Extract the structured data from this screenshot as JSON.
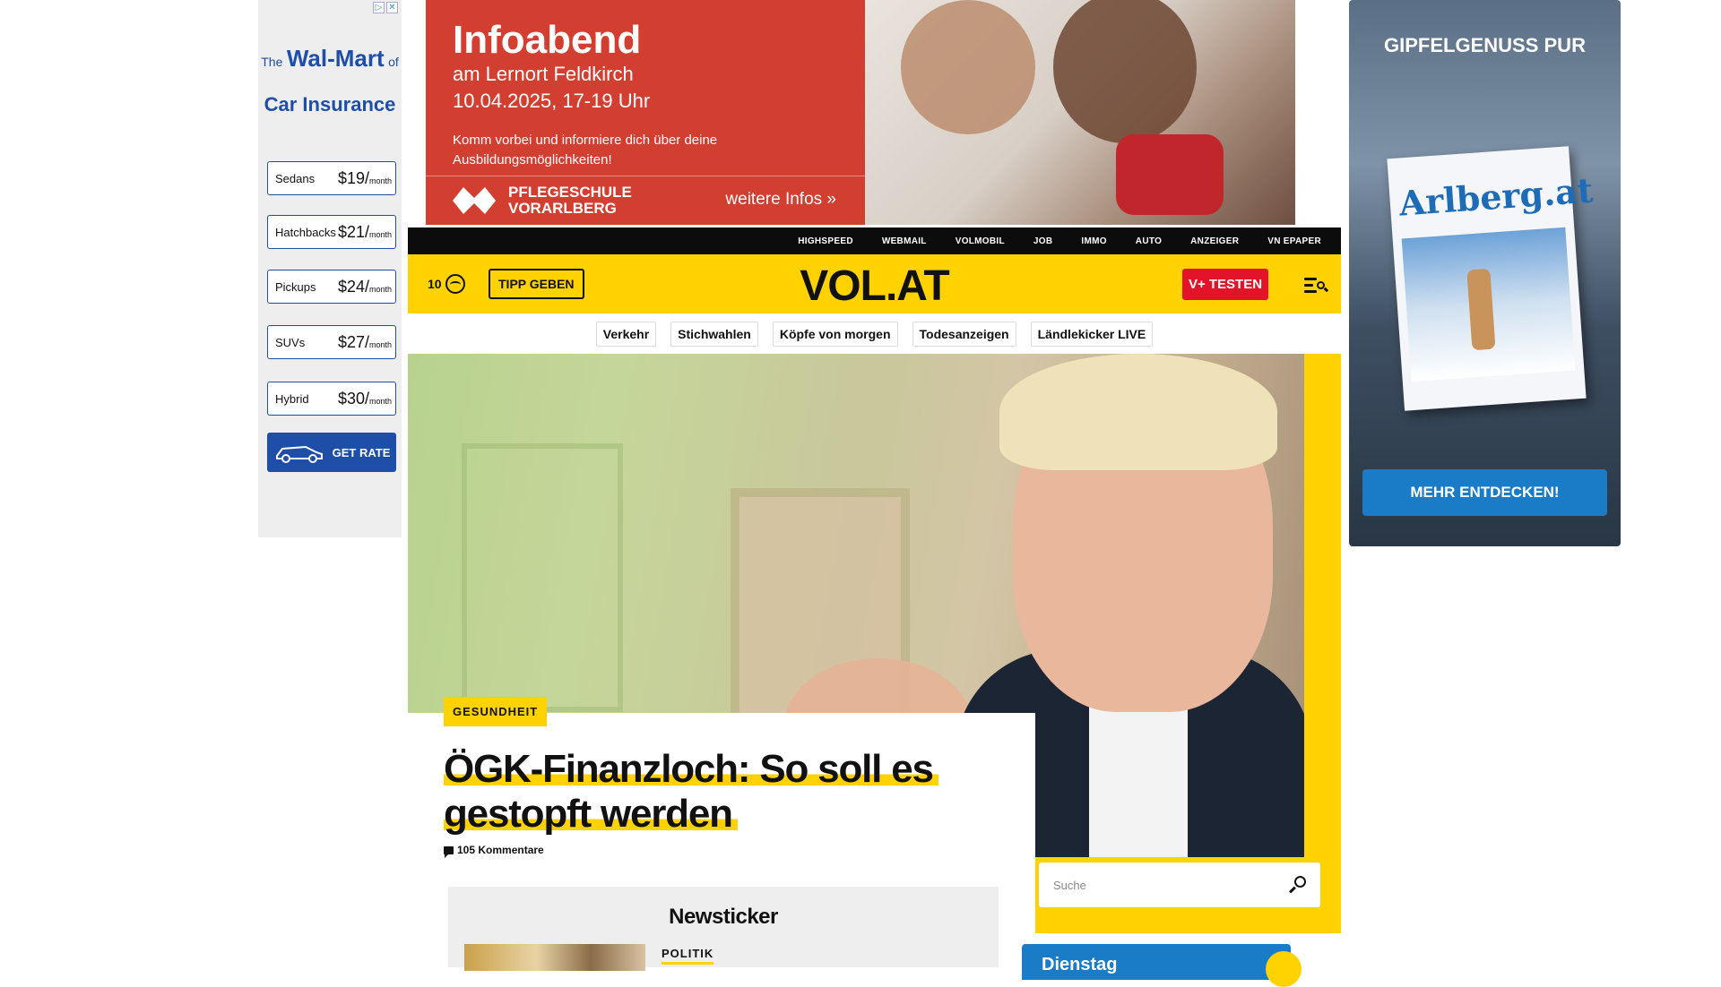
{
  "left_ad": {
    "adchoices": [
      "▷",
      "✕"
    ],
    "title_small_1": "The",
    "title_big": "Wal-Mart",
    "title_small_2": "of",
    "subtitle": "Car Insurance",
    "rates": [
      {
        "label": "Sedans",
        "price": "$19/",
        "unit": "month"
      },
      {
        "label": "Hatchbacks",
        "price": "$21/",
        "unit": "month"
      },
      {
        "label": "Pickups",
        "price": "$24/",
        "unit": "month"
      },
      {
        "label": "SUVs",
        "price": "$27/",
        "unit": "month"
      },
      {
        "label": "Hybrid",
        "price": "$30/",
        "unit": "month"
      }
    ],
    "cta": "GET RATE"
  },
  "top_banner": {
    "title": "Infoabend",
    "line1": "am Lernort Feldkirch",
    "line2": "10.04.2025, 17-19 Uhr",
    "desc": "Komm vorbei und informiere dich über deine Ausbildungsmöglichkeiten!",
    "logo_line1": "PFLEGESCHULE",
    "logo_line2": "VORARLBERG",
    "more": "weitere Infos »"
  },
  "right_ad": {
    "title": "GIPFELGENUSS PUR",
    "magazine": "Arlberg.at",
    "cta": "MEHR ENTDECKEN!"
  },
  "topnav": [
    "HIGHSPEED",
    "WEBMAIL",
    "VOLMOBIL",
    "JOB",
    "IMMO",
    "AUTO",
    "ANZEIGER",
    "VN EPAPER"
  ],
  "header": {
    "temperature": "10",
    "weather_icon": "cloud-icon",
    "tipp": "TIPP GEBEN",
    "logo": "VOL.AT",
    "vplus": "V+ TESTEN",
    "menu_icon": "menu-search-icon",
    "accent": "#ffd200"
  },
  "tags": [
    "Verkehr",
    "Stichwahlen",
    "Köpfe von morgen",
    "Todesanzeigen",
    "Ländlekicker LIVE"
  ],
  "article": {
    "kicker": "GESUNDHEIT",
    "headline": "ÖGK-Finanzloch: So soll es gestopft werden",
    "comments": "105 Kommentare"
  },
  "search": {
    "placeholder": "Suche"
  },
  "newsticker": {
    "title": "Newsticker",
    "first_kicker": "POLITIK"
  },
  "weather_widget": {
    "day": "Dienstag"
  }
}
